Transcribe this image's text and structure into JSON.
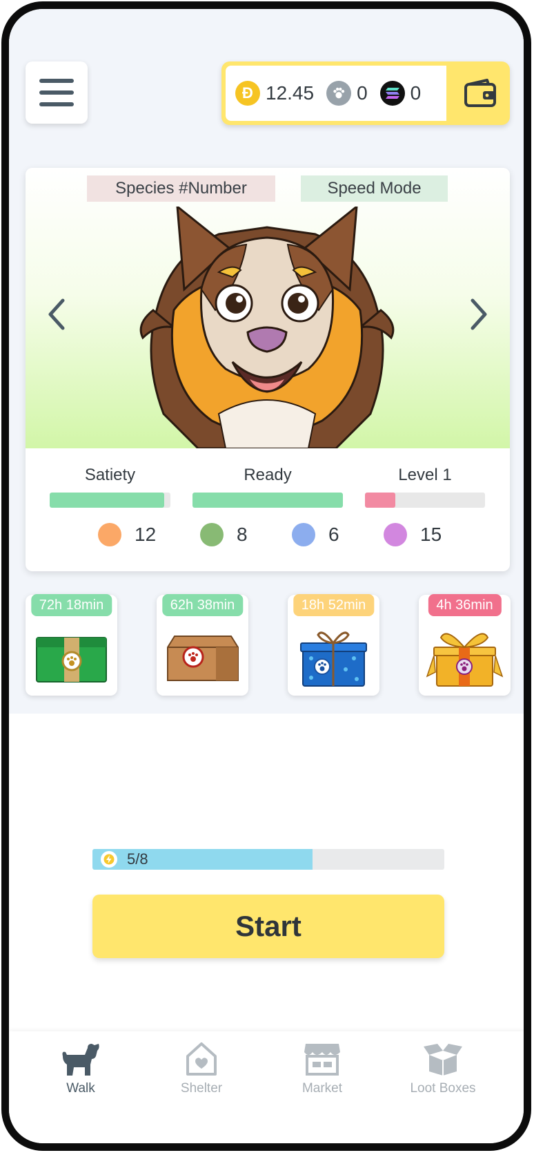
{
  "header": {
    "balances": [
      {
        "icon": "doge-coin-icon",
        "value": "12.45"
      },
      {
        "icon": "paw-token-icon",
        "value": "0"
      },
      {
        "icon": "solana-icon",
        "value": "0"
      }
    ]
  },
  "pet": {
    "species_tag": "Species #Number",
    "mode_tag": "Speed Mode",
    "stats": [
      {
        "label": "Satiety",
        "fill": 0.95,
        "color": "#86ddaa"
      },
      {
        "label": "Ready",
        "fill": 1.0,
        "color": "#86ddaa"
      },
      {
        "label": "Level 1",
        "fill": 0.25,
        "color": "#f28aa2"
      }
    ],
    "attributes": [
      {
        "color": "#fba867",
        "value": "12"
      },
      {
        "color": "#88ba74",
        "value": "8"
      },
      {
        "color": "#8cadee",
        "value": "6"
      },
      {
        "color": "#d287df",
        "value": "15"
      }
    ]
  },
  "loot_boxes": [
    {
      "timer": "72h 18min",
      "timer_color": "#86ddaa",
      "box": "green-box"
    },
    {
      "timer": "62h 38min",
      "timer_color": "#86ddaa",
      "box": "brown-parcel"
    },
    {
      "timer": "18h 52min",
      "timer_color": "#fdd37a",
      "box": "blue-gift"
    },
    {
      "timer": "4h 36min",
      "timer_color": "#f1708c",
      "box": "golden-gift"
    }
  ],
  "energy": {
    "text": "5/8",
    "fill": 0.625
  },
  "start_label": "Start",
  "nav": {
    "items": [
      {
        "label": "Walk",
        "icon": "dog-icon",
        "active": true
      },
      {
        "label": "Shelter",
        "icon": "house-heart-icon",
        "active": false
      },
      {
        "label": "Market",
        "icon": "market-stall-icon",
        "active": false
      },
      {
        "label": "Loot Boxes",
        "icon": "open-box-icon",
        "active": false
      }
    ]
  }
}
